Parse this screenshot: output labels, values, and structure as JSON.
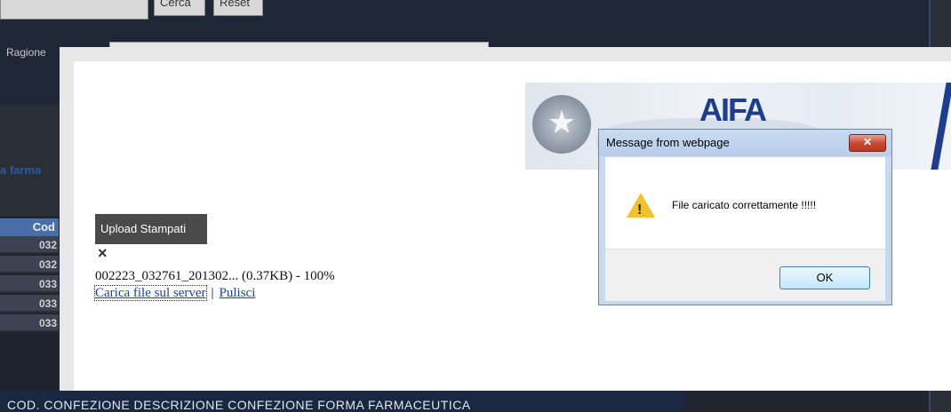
{
  "background": {
    "search_button": "Cerca",
    "reset_button": "Reset",
    "ragione_label": "Ragione",
    "farma_label": "a farma",
    "cod_header": "Cod",
    "rows": [
      "032",
      "032",
      "033",
      "033",
      "033"
    ],
    "footer_header": "COD. CONFEZIONE   DESCRIZIONE CONFEZIONE   FORMA FARMACEUTICA"
  },
  "banner": {
    "logo_text": "AIFA"
  },
  "upload": {
    "button_label": "Upload Stampati",
    "remove_icon": "×",
    "file_info": "002223_032761_201302... (0.37KB) - 100%",
    "upload_link": "Carica file sul server",
    "separator": "|",
    "clear_link": "Pulisci"
  },
  "dialog": {
    "title": "Message from webpage",
    "close_glyph": "✕",
    "message": "File caricato correttamente !!!!!",
    "ok_label": "OK"
  },
  "colors": {
    "modal_background": "#ffffff",
    "upload_button": "#4a4a4a",
    "link": "#1a3fb0",
    "warning": "#f2c12e",
    "logo": "#1e3d8f"
  }
}
